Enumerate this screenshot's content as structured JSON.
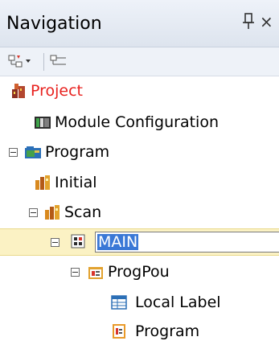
{
  "panel": {
    "title": "Navigation",
    "pin_icon": "pin-icon",
    "close_glyph": "×"
  },
  "toolbar": {
    "buttons": [
      {
        "name": "tree-view-options",
        "icon": "tree-dropdown-icon"
      },
      {
        "name": "collapse-all",
        "icon": "collapse-tree-icon"
      }
    ]
  },
  "tree": {
    "items": [
      {
        "label": "Project",
        "icon": "project-icon",
        "level": 0,
        "color": "#e8221f"
      },
      {
        "label": "Module Configuration",
        "icon": "module-configuration-icon",
        "level": 1
      },
      {
        "label": "Program",
        "icon": "program-folder-icon",
        "level": 0,
        "expanded": true
      },
      {
        "label": "Initial",
        "icon": "initial-icon",
        "level": 1
      },
      {
        "label": "Scan",
        "icon": "scan-icon",
        "level": 1,
        "expanded": true
      },
      {
        "label": "MAIN",
        "icon": "main-program-icon",
        "level": 2,
        "expanded": true,
        "editing": true
      },
      {
        "label": "ProgPou",
        "icon": "progpou-icon",
        "level": 3,
        "expanded": true
      },
      {
        "label": "Local Label",
        "icon": "local-label-icon",
        "level": 4
      },
      {
        "label": "Program",
        "icon": "program-file-icon",
        "level": 4
      }
    ]
  }
}
